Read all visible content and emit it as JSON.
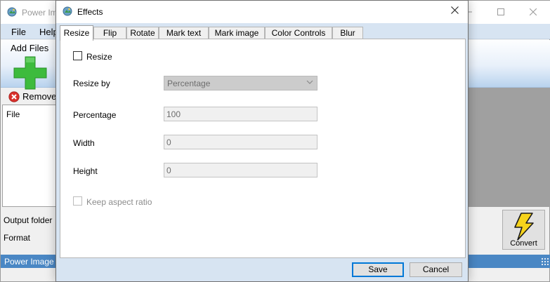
{
  "main_window": {
    "title": "Power Im",
    "menu": {
      "file": "File",
      "help": "Help"
    },
    "toolbar": {
      "add_files": "Add Files",
      "remove": "Remove"
    },
    "file_list": {
      "column_header": "File"
    },
    "labels": {
      "output_folder": "Output folder",
      "format": "Format"
    },
    "convert_label": "Convert",
    "status_text": "Power Image"
  },
  "dialog": {
    "title": "Effects",
    "tabs": [
      {
        "label": "Resize",
        "active": true
      },
      {
        "label": "Flip",
        "active": false
      },
      {
        "label": "Rotate",
        "active": false
      },
      {
        "label": "Mark text",
        "active": false
      },
      {
        "label": "Mark image",
        "active": false
      },
      {
        "label": "Color Controls",
        "active": false
      },
      {
        "label": "Blur",
        "active": false
      }
    ],
    "resize_tab": {
      "resize_checkbox_label": "Resize",
      "resize_checked": false,
      "resize_by_label": "Resize by",
      "resize_by_value": "Percentage",
      "percentage_label": "Percentage",
      "percentage_value": "100",
      "width_label": "Width",
      "width_value": "0",
      "height_label": "Height",
      "height_value": "0",
      "keep_aspect_label": "Keep aspect ratio",
      "keep_aspect_checked": false
    },
    "buttons": {
      "save": "Save",
      "cancel": "Cancel"
    }
  },
  "colors": {
    "accent_blue": "#0078d7",
    "menubar_bg": "#d7e4f2",
    "statusbar_bg": "#4a87c4",
    "add_icon_green": "#3dbb3d",
    "remove_icon_red": "#d9302c",
    "convert_icon_yellow": "#f6d31b"
  },
  "icons": {
    "app": "app-icon",
    "add": "plus-icon",
    "remove": "remove-x-icon",
    "convert": "lightning-bolt-icon",
    "dropdown": "chevron-down-icon",
    "close": "close-icon"
  }
}
